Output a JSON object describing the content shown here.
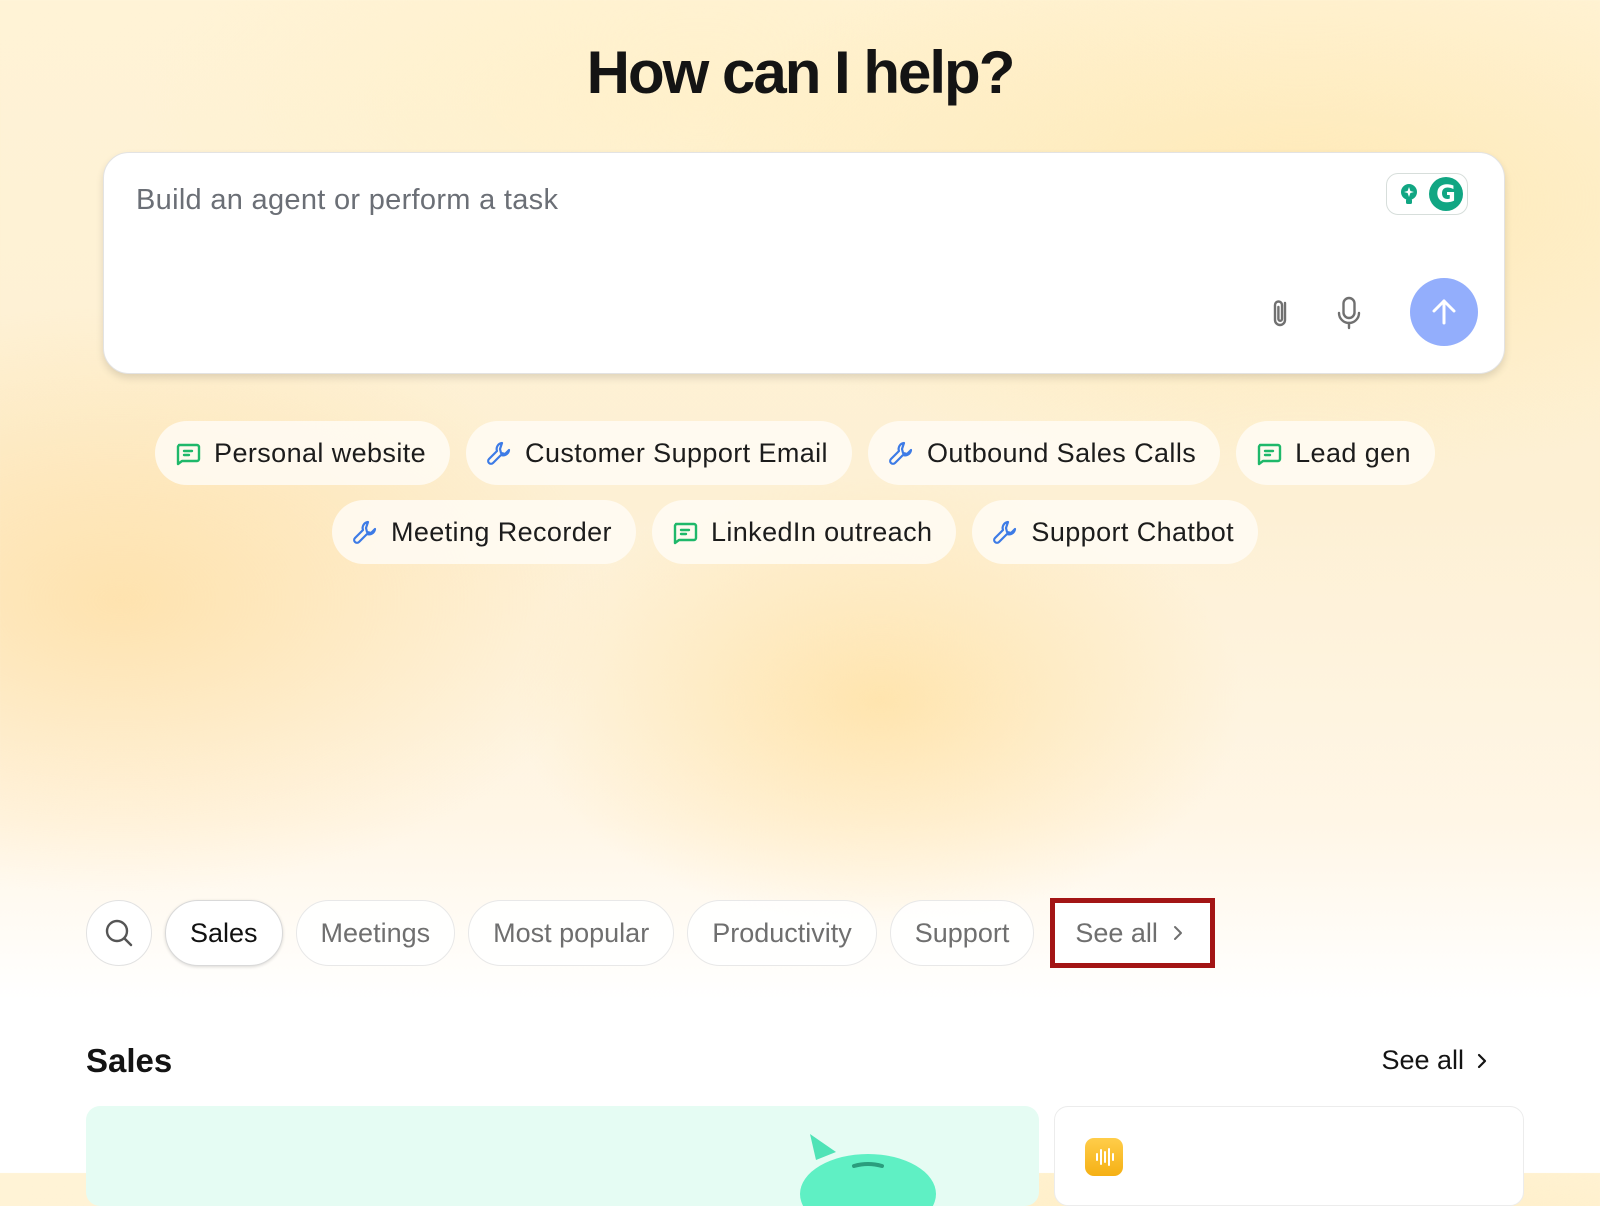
{
  "headline": "How can I help?",
  "prompt": {
    "placeholder": "Build an agent or perform a task",
    "value": ""
  },
  "suggestions": {
    "row1": [
      {
        "label": "Personal website",
        "icon": "chat-icon"
      },
      {
        "label": "Customer Support Email",
        "icon": "wrench-icon"
      },
      {
        "label": "Outbound Sales Calls",
        "icon": "wrench-icon"
      },
      {
        "label": "Lead gen",
        "icon": "chat-icon"
      }
    ],
    "row2": [
      {
        "label": "Meeting Recorder",
        "icon": "wrench-icon"
      },
      {
        "label": "LinkedIn outreach",
        "icon": "chat-icon"
      },
      {
        "label": "Support Chatbot",
        "icon": "wrench-icon"
      }
    ]
  },
  "filters": {
    "chips": [
      {
        "label": "Sales",
        "active": true
      },
      {
        "label": "Meetings",
        "active": false
      },
      {
        "label": "Most popular",
        "active": false
      },
      {
        "label": "Productivity",
        "active": false
      },
      {
        "label": "Support",
        "active": false
      }
    ],
    "see_all": "See all"
  },
  "section": {
    "title": "Sales",
    "see_all": "See all"
  },
  "colors": {
    "accent_send": "#93aefc",
    "chat_icon": "#1fb86a",
    "wrench_icon": "#3d7be6",
    "highlight_border": "#a31515",
    "card_mint": "#e5fcf3",
    "audio_badge": "#f5b014",
    "grammarly_green": "#11a683"
  }
}
